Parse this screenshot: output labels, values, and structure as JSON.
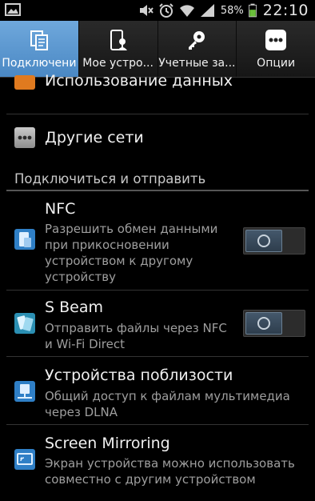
{
  "status_bar": {
    "battery_percent": "58%",
    "time": "22:10",
    "icons": [
      "gallery-icon",
      "mute-icon",
      "alarm-icon",
      "wifi-icon",
      "signal-icon",
      "battery-icon"
    ]
  },
  "tabs": [
    {
      "label": "Подключени",
      "icon": "connections-icon",
      "active": true
    },
    {
      "label": "Мое устро...",
      "icon": "my-device-icon",
      "active": false
    },
    {
      "label": "Учетные за...",
      "icon": "accounts-icon",
      "active": false
    },
    {
      "label": "Опции",
      "icon": "options-icon",
      "active": false
    }
  ],
  "list": {
    "data_usage": {
      "title": "Использование данных",
      "icon": "data-usage-icon"
    },
    "other_networks": {
      "title": "Другие сети",
      "icon": "more-networks-icon"
    },
    "section_title": "Подключиться и отправить",
    "nfc": {
      "title": "NFC",
      "lines": [
        "Разрешить обмен данными",
        "при прикосновении",
        "устройством к другому",
        "устройству"
      ],
      "toggle": "off",
      "icon": "nfc-icon"
    },
    "s_beam": {
      "title": "S Beam",
      "lines": [
        "Отправить файлы через NFC",
        "и Wi-Fi Direct"
      ],
      "toggle": "off",
      "icon": "s-beam-icon"
    },
    "nearby": {
      "title": "Устройства поблизости",
      "lines": [
        "Общий доступ к файлам мультимедиа",
        "через DLNA"
      ],
      "icon": "nearby-devices-icon"
    },
    "mirroring": {
      "title": "Screen Mirroring",
      "lines": [
        "Экран устройства можно использовать",
        "совместно с другим устройством"
      ],
      "icon": "screen-mirroring-icon"
    }
  },
  "colors": {
    "active_tab": "#5b98d2",
    "accent_icon": "#3d8fd8",
    "data_usage_icon": "#e07a1f"
  }
}
